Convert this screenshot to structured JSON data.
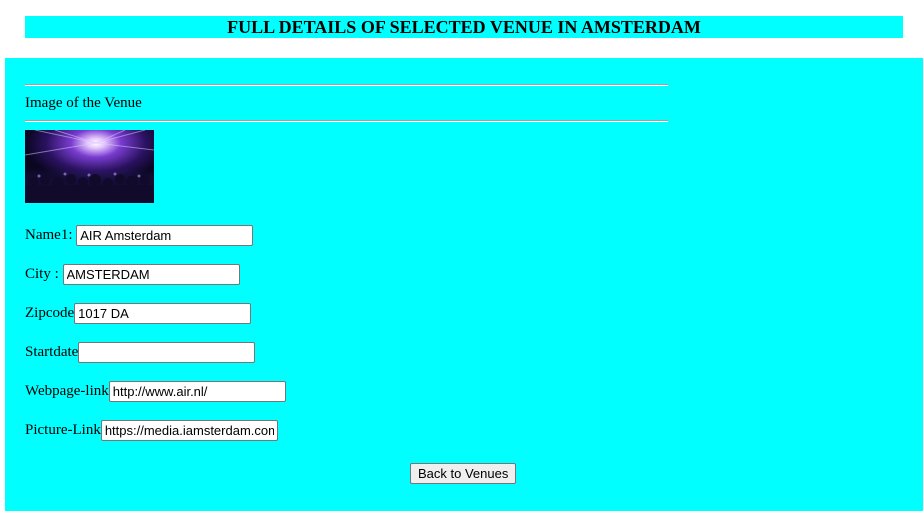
{
  "header": {
    "title": "FULL DETAILS OF SELECTED VENUE IN AMSTERDAM"
  },
  "colors": {
    "panel_background": "#00ffff",
    "page_background": "#ffffff"
  },
  "image_section": {
    "caption": "Image of the Venue"
  },
  "fields": {
    "name": {
      "label": "Name1: ",
      "value": "AIR Amsterdam"
    },
    "city": {
      "label": "City : ",
      "value": "AMSTERDAM"
    },
    "zipcode": {
      "label": "Zipcode",
      "value": "1017 DA"
    },
    "startdate": {
      "label": "Startdate",
      "value": ""
    },
    "webpage": {
      "label": "Webpage-link",
      "value": "http://www.air.nl/"
    },
    "picture": {
      "label": "Picture-Link",
      "value": "https://media.iamsterdam.com"
    }
  },
  "actions": {
    "back_label": "Back to Venues"
  }
}
